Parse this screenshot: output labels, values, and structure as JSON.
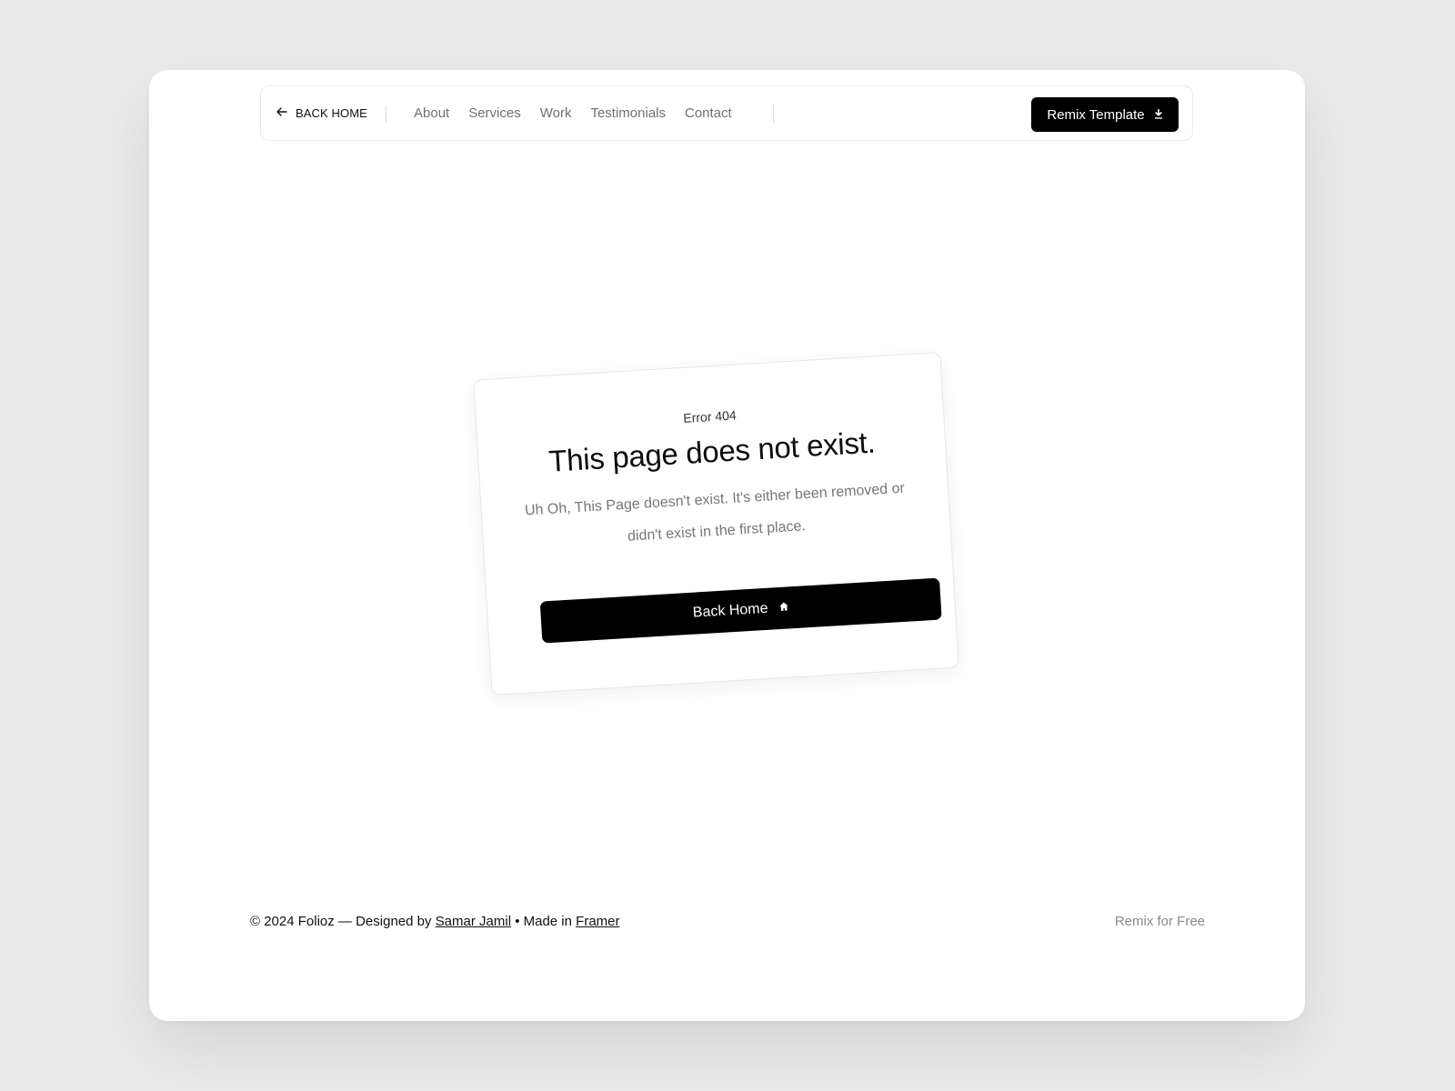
{
  "nav": {
    "back_label": "BACK HOME",
    "links": [
      "About",
      "Services",
      "Work",
      "Testimonials",
      "Contact"
    ],
    "cta_label": "Remix Template"
  },
  "error_card": {
    "code": "Error 404",
    "title": "This page does not exist.",
    "description": "Uh Oh, This Page doesn't exist. It's either been removed or didn't exist in the first place.",
    "button_label": "Back Home"
  },
  "footer": {
    "copyright": "© 2024 Folioz — Designed by",
    "designer": "Samar Jamil",
    "made_in_text": "• Made in",
    "platform": "Framer",
    "remix_label": "Remix for Free"
  },
  "colors": {
    "background": "#ebebeb",
    "surface": "#ffffff",
    "primary": "#000000",
    "muted_text": "#707070"
  },
  "icons": {
    "back": "arrow-left-icon",
    "cta": "download-icon",
    "home": "home-icon"
  }
}
